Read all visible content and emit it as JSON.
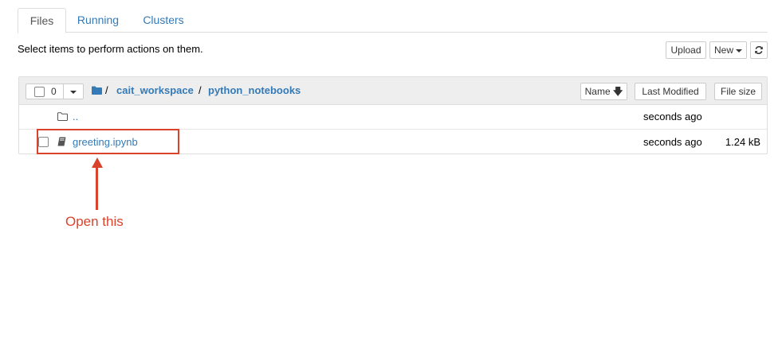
{
  "tabs": [
    {
      "label": "Files",
      "active": true
    },
    {
      "label": "Running",
      "active": false
    },
    {
      "label": "Clusters",
      "active": false
    }
  ],
  "toolbar": {
    "instructions": "Select items to perform actions on them.",
    "upload_label": "Upload",
    "new_label": "New",
    "refresh_icon": "refresh-icon"
  },
  "list_header": {
    "selected_count": "0",
    "breadcrumb": [
      {
        "label": "/"
      },
      {
        "label": "cait_workspace"
      },
      {
        "label": "/"
      },
      {
        "label": "python_notebooks"
      }
    ],
    "sort_name_label": "Name",
    "sort_last_modified_label": "Last Modified",
    "sort_file_size_label": "File size"
  },
  "files": [
    {
      "name": "..",
      "type": "folder",
      "modified": "seconds ago",
      "size": ""
    },
    {
      "name": "greeting.ipynb",
      "type": "notebook",
      "modified": "seconds ago",
      "size": "1.24 kB"
    }
  ],
  "annotation": {
    "text": "Open this",
    "color": "#d9432c"
  }
}
